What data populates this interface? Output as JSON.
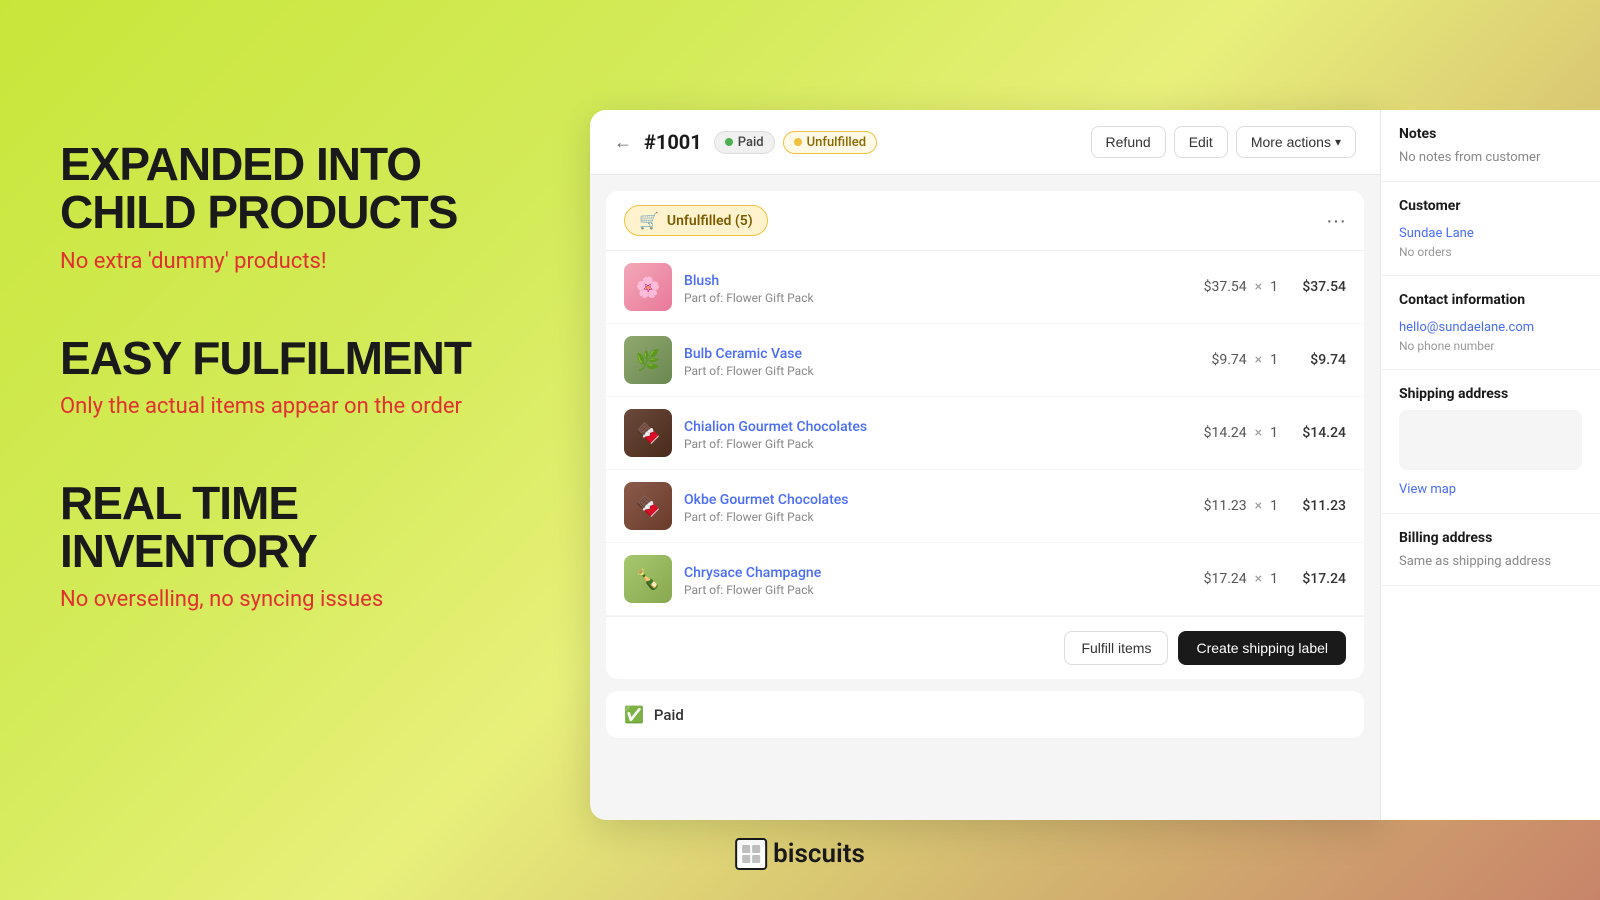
{
  "background": {
    "gradient": "lime-to-salmon"
  },
  "left_panel": {
    "features": [
      {
        "title": "EXPANDED INTO CHILD PRODUCTS",
        "subtitle": "No extra 'dummy' products!"
      },
      {
        "title": "EASY FULFILMENT",
        "subtitle": "Only the actual items appear on the order"
      },
      {
        "title": "REAL TIME INVENTORY",
        "subtitle": "No overselling, no syncing issues"
      }
    ]
  },
  "logo": {
    "text": "biscuits",
    "icon": "🍪"
  },
  "order": {
    "number": "#1001",
    "badges": {
      "paid": "Paid",
      "unfulfilled": "Unfulfilled"
    },
    "header_buttons": {
      "refund": "Refund",
      "edit": "Edit",
      "more_actions": "More actions"
    },
    "unfulfilled_section": {
      "label": "Unfulfilled (5)",
      "icon": "🛒",
      "line_items": [
        {
          "name": "Blush",
          "meta": "Part of: Flower Gift Pack",
          "unit_price": "$37.54",
          "qty": "1",
          "total": "$37.54",
          "img_class": "img-blush",
          "emoji": "🌸"
        },
        {
          "name": "Bulb Ceramic Vase",
          "meta": "Part of: Flower Gift Pack",
          "unit_price": "$9.74",
          "qty": "1",
          "total": "$9.74",
          "img_class": "img-vase",
          "emoji": "🌿"
        },
        {
          "name": "Chialion Gourmet Chocolates",
          "meta": "Part of: Flower Gift Pack",
          "unit_price": "$14.24",
          "qty": "1",
          "total": "$14.24",
          "img_class": "img-choc",
          "emoji": "🍫"
        },
        {
          "name": "Okbe Gourmet Chocolates",
          "meta": "Part of: Flower Gift Pack",
          "unit_price": "$11.23",
          "qty": "1",
          "total": "$11.23",
          "img_class": "img-okbe",
          "emoji": "🍫"
        },
        {
          "name": "Chrysace Champagne",
          "meta": "Part of: Flower Gift Pack",
          "unit_price": "$17.24",
          "qty": "1",
          "total": "$17.24",
          "img_class": "img-champ",
          "emoji": "🍾"
        }
      ],
      "actions": {
        "fulfill": "Fulfill items",
        "shipping": "Create shipping label"
      }
    },
    "paid_section": {
      "label": "Paid"
    }
  },
  "sidebar": {
    "notes": {
      "title": "Notes",
      "content": "No notes from customer"
    },
    "customer": {
      "title": "Customer",
      "name": "Sundae Lane",
      "orders": "No orders"
    },
    "contact": {
      "title": "Contact information",
      "email": "hello@sundaelane.com",
      "phone": "No phone number"
    },
    "shipping_address": {
      "title": "Shipping address",
      "view_map": "View map"
    },
    "billing_address": {
      "title": "Billing address",
      "content": "Same as shipping address"
    }
  }
}
